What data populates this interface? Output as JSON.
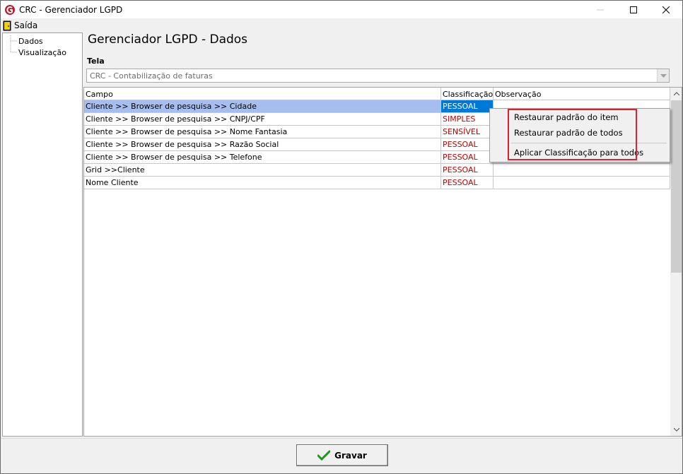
{
  "window": {
    "title": "CRC - Gerenciador LGPD",
    "brand_color": "#c0182c"
  },
  "menu": {
    "exit_label": "Saída"
  },
  "tree": {
    "items": [
      {
        "label": "Dados"
      },
      {
        "label": "Visualização"
      }
    ]
  },
  "main": {
    "title": "Gerenciador LGPD - Dados",
    "tela_label": "Tela",
    "tela_value": "CRC - Contabilização de faturas"
  },
  "grid": {
    "headers": [
      "Campo",
      "Classificação",
      "Observação"
    ],
    "rows": [
      {
        "campo": "Cliente >> Browser de pesquisa >> Cidade",
        "classificacao": "PESSOAL",
        "observacao": ""
      },
      {
        "campo": "Cliente >> Browser de pesquisa >> CNPJ/CPF",
        "classificacao": "SIMPLES",
        "observacao": ""
      },
      {
        "campo": "Cliente >> Browser de pesquisa >> Nome Fantasia",
        "classificacao": "SENSÍVEL",
        "observacao": ""
      },
      {
        "campo": "Cliente >> Browser de pesquisa >> Razão Social",
        "classificacao": "PESSOAL",
        "observacao": ""
      },
      {
        "campo": "Cliente >> Browser de pesquisa >> Telefone",
        "classificacao": "PESSOAL",
        "observacao": ""
      },
      {
        "campo": "Grid >>Cliente",
        "classificacao": "PESSOAL",
        "observacao": ""
      },
      {
        "campo": "Nome Cliente",
        "classificacao": "PESSOAL",
        "observacao": ""
      }
    ],
    "classification_color": "#c00000"
  },
  "context_menu": {
    "items": [
      {
        "label": "Restaurar padrão do item"
      },
      {
        "label": "Restaurar padrão de todos"
      },
      {
        "label": "Aplicar Classificação para todos"
      }
    ],
    "highlight_color": "#e0202a"
  },
  "footer": {
    "save_label": "Gravar",
    "save_icon": "checkmark-icon",
    "save_icon_color": "#1a9a1a"
  }
}
